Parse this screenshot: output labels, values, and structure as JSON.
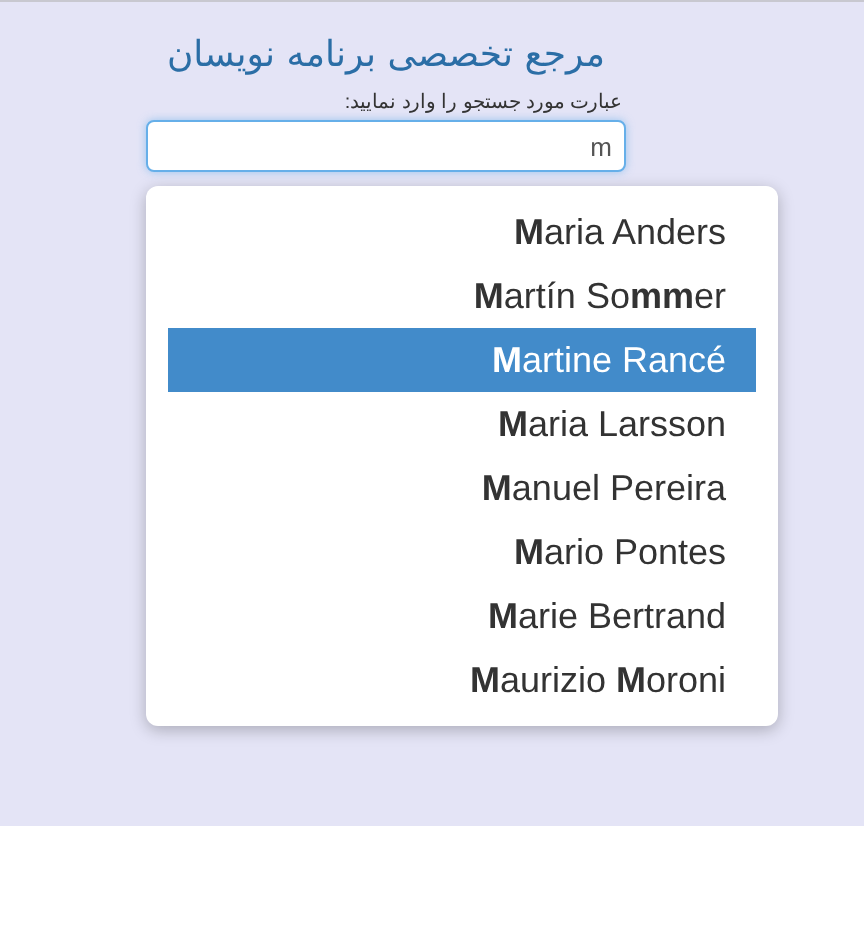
{
  "title": "مرجع تخصصی برنامه نویسان",
  "search": {
    "label": "عبارت مورد جستجو را وارد نمایید:",
    "value": "m"
  },
  "suggestions": [
    {
      "label": "**M**aria Anders",
      "selected": false
    },
    {
      "label": "**M**artín So**mm**er",
      "selected": false
    },
    {
      "label": "**M**artine Rancé",
      "selected": true
    },
    {
      "label": "**M**aria Larsson",
      "selected": false
    },
    {
      "label": "**M**anuel Pereira",
      "selected": false
    },
    {
      "label": "**M**ario Pontes",
      "selected": false
    },
    {
      "label": "**M**arie Bertrand",
      "selected": false
    },
    {
      "label": "**M**aurizio **M**oroni",
      "selected": false
    }
  ]
}
